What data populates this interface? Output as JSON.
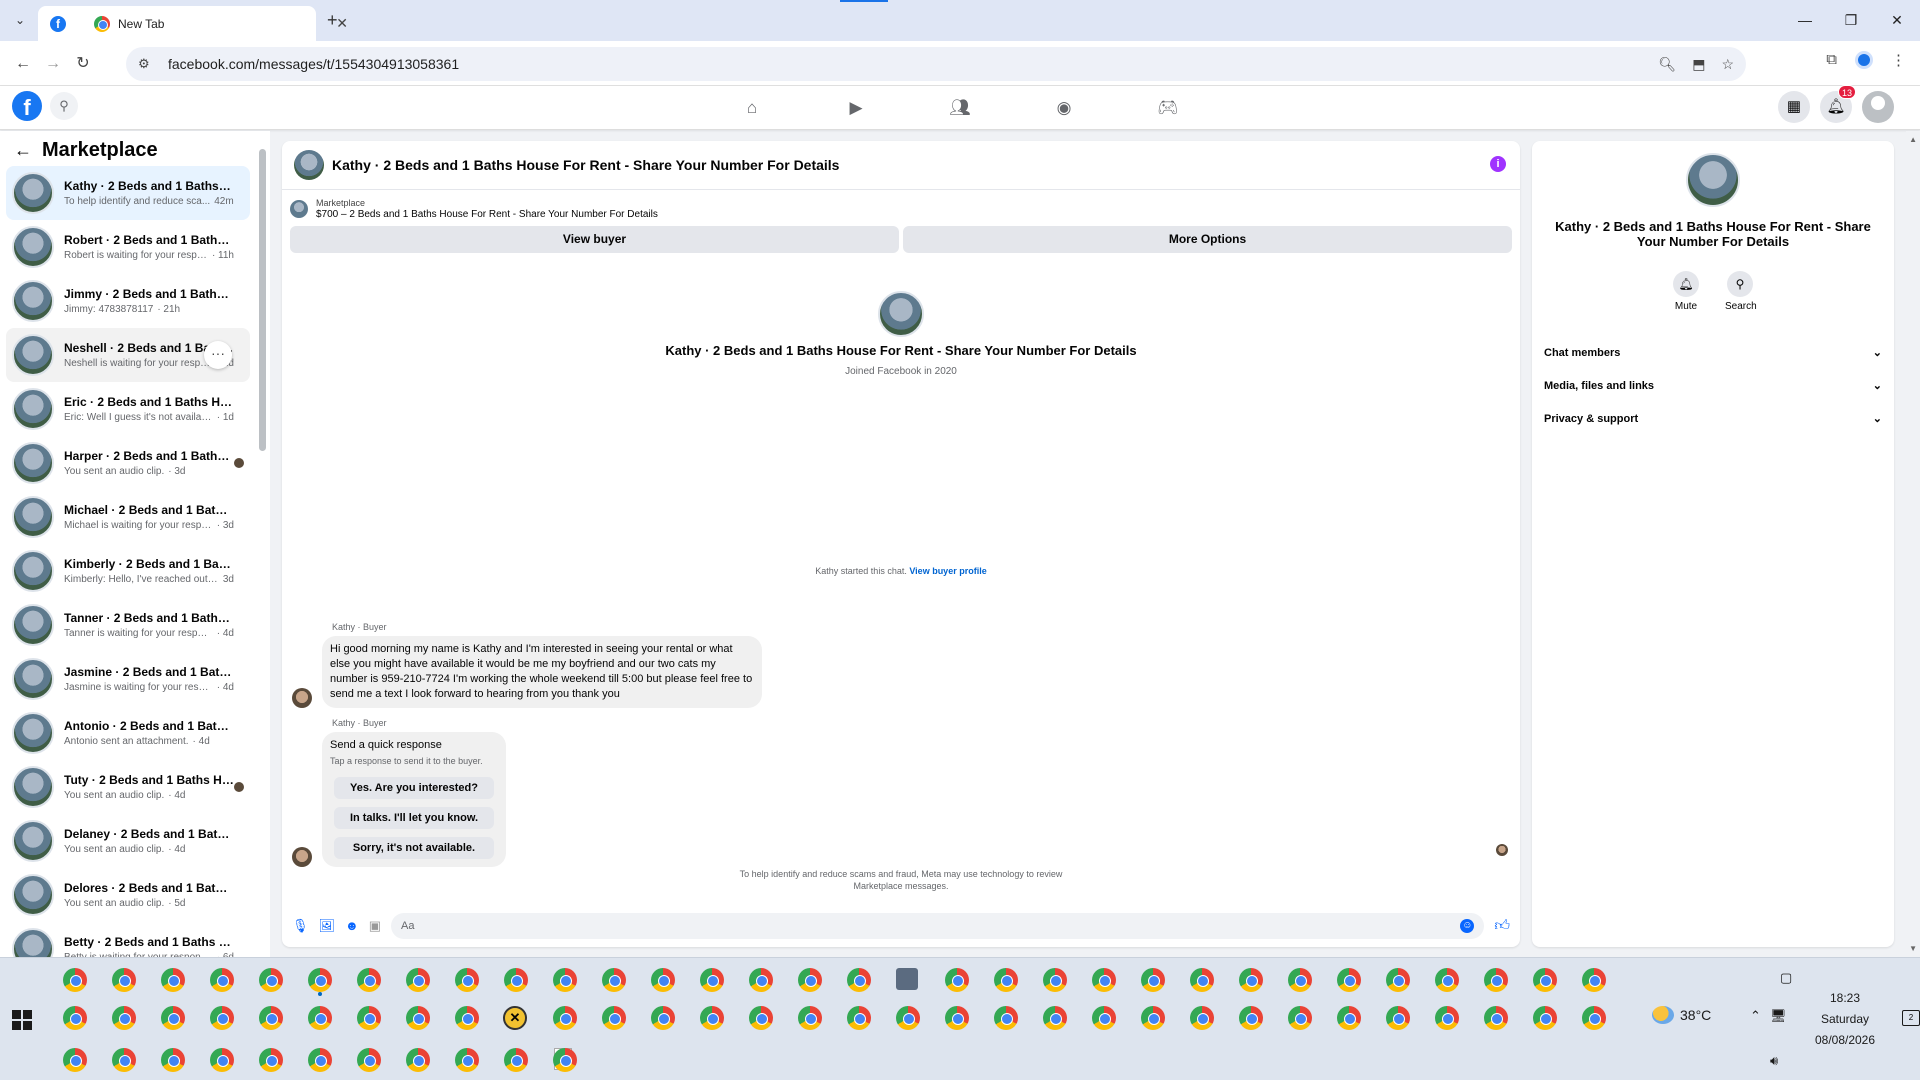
{
  "browser": {
    "tabs": [
      {
        "label": "",
        "icon": "facebook-icon",
        "active": true
      },
      {
        "label": "New Tab",
        "icon": "chrome-icon",
        "active": false
      }
    ],
    "url": "facebook.com/messages/t/1554304913058361",
    "new_tab_symbol": "+"
  },
  "facebook": {
    "notification_count": "13"
  },
  "sidebar": {
    "title": "Marketplace",
    "conversations": [
      {
        "name": "Kathy · 2 Beds and 1 Baths Hou...",
        "snippet": "To help identify and reduce sca...",
        "time": "42m"
      },
      {
        "name": "Robert · 2 Beds and 1 Baths Ho...",
        "snippet": "Robert is waiting for your respon...",
        "time": "· 11h"
      },
      {
        "name": "Jimmy · 2 Beds and 1 Baths Hou...",
        "snippet": "Jimmy: 4783878117",
        "time": "· 21h"
      },
      {
        "name": "Neshell · 2 Beds and 1 Baths ...",
        "snippet": "Neshell is waiting for your respo...",
        "time": "· 1d"
      },
      {
        "name": "Eric · 2 Beds and 1 Baths House ...",
        "snippet": "Eric: Well I guess it's not available ...",
        "time": "· 1d"
      },
      {
        "name": "Harper · 2 Beds and 1 Baths ...",
        "snippet": "You sent an audio clip.",
        "time": "· 3d"
      },
      {
        "name": "Michael · 2 Beds and 1 Baths Ho...",
        "snippet": "Michael is waiting for your respon...",
        "time": "· 3d"
      },
      {
        "name": "Kimberly · 2 Beds and 1 Baths H...",
        "snippet": "Kimberly: Hello, I've reached out a ...",
        "time": "3d"
      },
      {
        "name": "Tanner · 2 Beds and 1 Baths Ho...",
        "snippet": "Tanner is waiting for your response.",
        "time": "· 4d"
      },
      {
        "name": "Jasmine · 2 Beds and 1 Baths H...",
        "snippet": "Jasmine is waiting for your respon...",
        "time": "· 4d"
      },
      {
        "name": "Antonio · 2 Beds and 1 Baths H...",
        "snippet": "Antonio sent an attachment.",
        "time": "· 4d"
      },
      {
        "name": "Tuty · 2 Beds and 1 Baths Ho...",
        "snippet": "You sent an audio clip.",
        "time": "· 4d"
      },
      {
        "name": "Delaney · 2 Beds and 1 Baths H...",
        "snippet": "You sent an audio clip.",
        "time": "· 4d"
      },
      {
        "name": "Delores · 2 Beds and 1 Baths Ho...",
        "snippet": "You sent an audio clip.",
        "time": "· 5d"
      },
      {
        "name": "Betty · 2 Beds and 1 Baths Hous...",
        "snippet": "Betty is waiting for your response.",
        "time": "· 6d"
      }
    ]
  },
  "chat": {
    "title": "Kathy · 2 Beds and 1 Baths House For Rent - Share Your Number For Details",
    "listing_source": "Marketplace",
    "listing_title": "$700 – 2 Beds and 1 Baths House For Rent - Share Your Number For Details",
    "view_buyer_label": "View buyer",
    "more_options_label": "More Options",
    "intro_name": "Kathy · 2 Beds and 1 Baths House For Rent - Share Your Number For Details",
    "intro_sub": "Joined Facebook in 2020",
    "started_text": "Kathy started this chat.",
    "view_profile_link": "View buyer profile",
    "message_sender": "Kathy · Buyer",
    "message_text": "Hi good morning my name is Kathy and I'm interested in seeing your rental or what else you might have available it would be me my boyfriend and our two cats my number is 959-210-7724 I'm working the whole weekend till 5:00 but please feel free to send me a text I look forward to hearing from you thank you",
    "quick_sender": "Kathy · Buyer",
    "quick_title": "Send a quick response",
    "quick_sub": "Tap a response to send it to the buyer.",
    "quick_replies": [
      "Yes. Are you interested?",
      "In talks. I'll let you know.",
      "Sorry, it's not available."
    ],
    "disclaimer_line1": "To help identify and reduce scams and fraud, Meta may use technology to review",
    "disclaimer_line2": "Marketplace messages.",
    "composer_placeholder": "Aa"
  },
  "right_panel": {
    "name": "Kathy · 2 Beds and 1 Baths House For Rent - Share Your Number For Details",
    "mute_label": "Mute",
    "search_label": "Search",
    "sections": [
      "Chat members",
      "Media, files and links",
      "Privacy & support"
    ]
  },
  "taskbar": {
    "temperature": "38°C",
    "time": "18:23",
    "day": "Saturday",
    "date": "08/08/2026",
    "notification_count": "2"
  }
}
